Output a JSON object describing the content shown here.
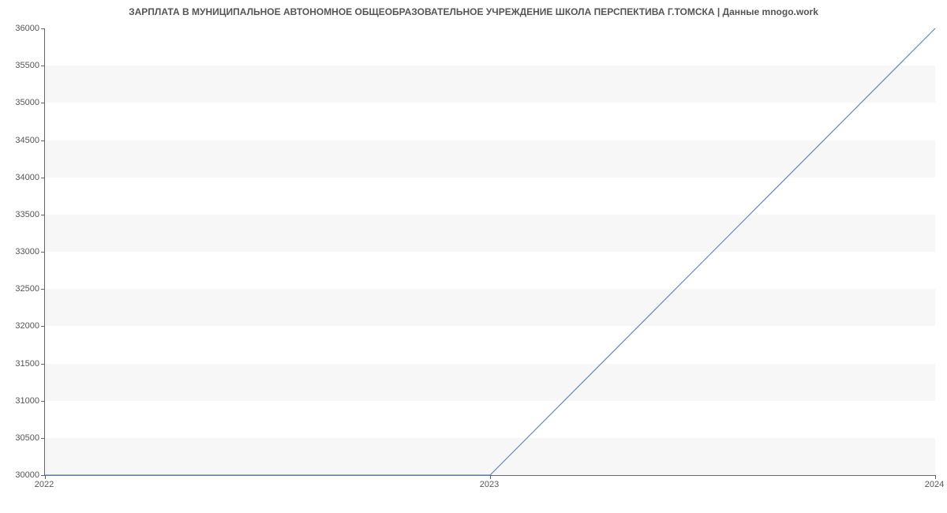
{
  "chart_data": {
    "type": "line",
    "title": "ЗАРПЛАТА В МУНИЦИПАЛЬНОЕ АВТОНОМНОЕ ОБЩЕОБРАЗОВАТЕЛЬНОЕ УЧРЕЖДЕНИЕ ШКОЛА  ПЕРСПЕКТИВА Г.ТОМСКА | Данные mnogo.work",
    "x": [
      2022,
      2023,
      2024
    ],
    "y": [
      30000,
      30000,
      36000
    ],
    "x_ticks": [
      2022,
      2023,
      2024
    ],
    "y_ticks": [
      30000,
      30500,
      31000,
      31500,
      32000,
      32500,
      33000,
      33500,
      34000,
      34500,
      35000,
      35500,
      36000
    ],
    "xlim": [
      2022,
      2024
    ],
    "ylim": [
      30000,
      36000
    ],
    "xlabel": "",
    "ylabel": "",
    "line_color": "#6288c0",
    "grid_band_color": "#f7f7f7"
  }
}
